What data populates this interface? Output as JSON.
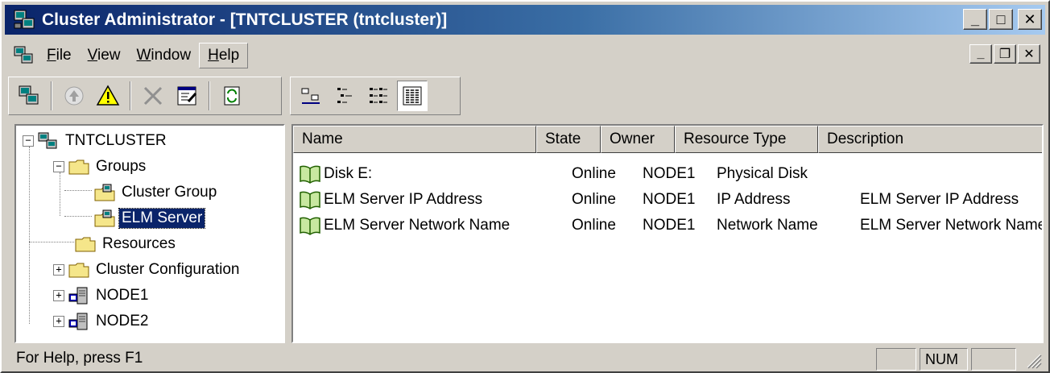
{
  "window": {
    "title": "Cluster Administrator - [TNTCLUSTER (tntcluster)]"
  },
  "caption_buttons": {
    "minimize": "_",
    "maximize": "□",
    "close": "✕"
  },
  "mdi_buttons": {
    "minimize": "_",
    "restore": "❐",
    "close": "✕"
  },
  "menu": [
    {
      "pre": "",
      "key": "F",
      "post": "ile"
    },
    {
      "pre": "",
      "key": "V",
      "post": "iew"
    },
    {
      "pre": "",
      "key": "W",
      "post": "indow"
    },
    {
      "pre": "",
      "key": "H",
      "post": "elp"
    }
  ],
  "toolbar": {
    "buttons": [
      "open-connection-icon",
      "bring-online-icon",
      "take-offline-icon",
      "delete-icon",
      "properties-icon",
      "refresh-icon",
      "large-icons-view-icon",
      "small-icons-view-icon",
      "list-view-icon",
      "details-view-icon"
    ],
    "pressed": "details-view-icon"
  },
  "tree": {
    "root": "TNTCLUSTER",
    "groups": "Groups",
    "cluster_group": "Cluster Group",
    "elm_server": "ELM Server",
    "resources": "Resources",
    "cluster_configuration": "Cluster Configuration",
    "node1": "NODE1",
    "node2": "NODE2",
    "selected": "ELM Server",
    "expander_minus": "−",
    "expander_plus": "+"
  },
  "list": {
    "columns": [
      "Name",
      "State",
      "Owner",
      "Resource Type",
      "Description"
    ],
    "rows": [
      {
        "name": "Disk E:",
        "state": "Online",
        "owner": "NODE1",
        "type": "Physical Disk",
        "description": ""
      },
      {
        "name": "ELM Server IP Address",
        "state": "Online",
        "owner": "NODE1",
        "type": "IP Address",
        "description": "ELM Server IP Address"
      },
      {
        "name": "ELM Server Network Name",
        "state": "Online",
        "owner": "NODE1",
        "type": "Network Name",
        "description": "ELM Server Network Name"
      }
    ]
  },
  "status": {
    "text": "For Help, press F1",
    "num": "NUM"
  },
  "colors": {
    "titlebar_start": "#0a246a",
    "titlebar_end": "#a6caf0",
    "selection": "#0a246a",
    "face": "#d4d0c8"
  }
}
